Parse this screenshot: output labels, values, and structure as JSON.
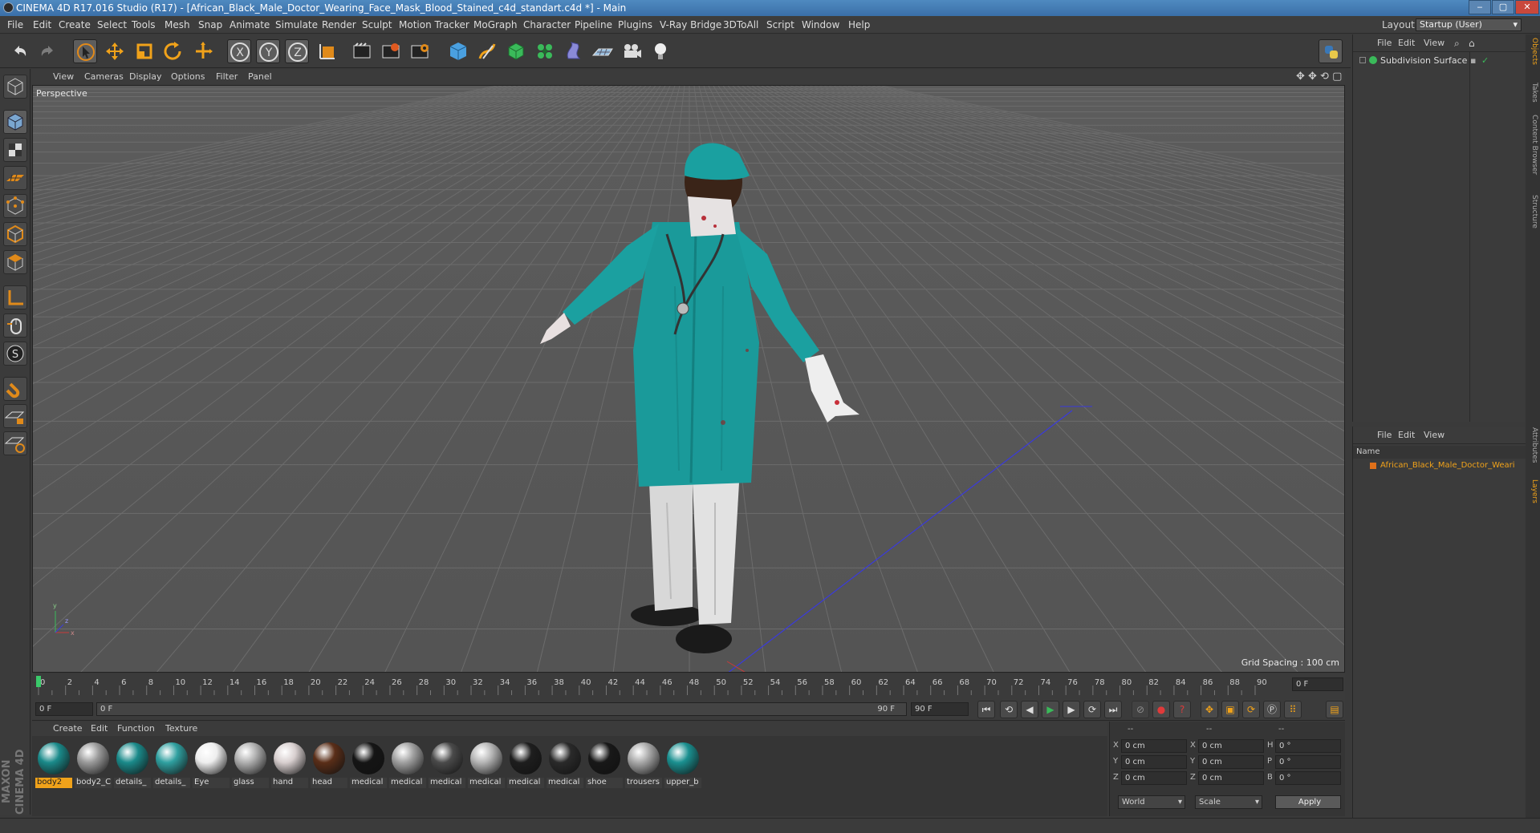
{
  "window": {
    "title": "CINEMA 4D R17.016 Studio (R17) - [African_Black_Male_Doctor_Wearing_Face_Mask_Blood_Stained_c4d_standart.c4d *] - Main",
    "minimize": "‒",
    "maximize": "▢",
    "close": "✕"
  },
  "menu": [
    "File",
    "Edit",
    "Create",
    "Select",
    "Tools",
    "Mesh",
    "Snap",
    "Animate",
    "Simulate",
    "Render",
    "Sculpt",
    "Motion Tracker",
    "MoGraph",
    "Character",
    "Pipeline",
    "Plugins",
    "V-Ray Bridge",
    "3DToAll",
    "Script",
    "Window",
    "Help"
  ],
  "layout": {
    "label": "Layout:",
    "value": "Startup (User)"
  },
  "toolbar": {
    "icons": [
      "undo-icon",
      "redo-icon",
      "live-selection-icon",
      "move-icon",
      "scale-icon",
      "rotate-icon",
      "recent-tool-icon",
      "x-axis-icon",
      "y-axis-icon",
      "z-axis-icon",
      "coordinate-system-icon",
      "render-view-icon",
      "render-picture-viewer-icon",
      "edit-render-settings-icon",
      "cube-icon",
      "pen-icon",
      "subdivision-icon",
      "cloner-icon",
      "deformer-icon",
      "floor-icon",
      "camera-icon",
      "light-icon"
    ],
    "axis_x": "X",
    "axis_y": "Y",
    "axis_z": "Z"
  },
  "viewport": {
    "menu": [
      "View",
      "Cameras",
      "Display",
      "Options",
      "Filter",
      "Panel"
    ],
    "label": "Perspective",
    "grid_spacing": "Grid Spacing : 100 cm"
  },
  "timeline": {
    "ticks": [
      "0",
      "2",
      "4",
      "6",
      "8",
      "10",
      "12",
      "14",
      "16",
      "18",
      "20",
      "22",
      "24",
      "26",
      "28",
      "30",
      "32",
      "34",
      "36",
      "38",
      "40",
      "42",
      "44",
      "46",
      "48",
      "50",
      "52",
      "54",
      "56",
      "58",
      "60",
      "62",
      "64",
      "66",
      "68",
      "70",
      "72",
      "74",
      "76",
      "78",
      "80",
      "82",
      "84",
      "86",
      "88",
      "90"
    ],
    "current_frame": "0 F",
    "start_field": "0 F",
    "slider_start": "0 F",
    "slider_end": "90 F",
    "end_field": "90 F"
  },
  "materials_menu": [
    "Create",
    "Edit",
    "Function",
    "Texture"
  ],
  "materials": [
    {
      "name": "body2",
      "color": "#1a8a8a",
      "selected": true
    },
    {
      "name": "body2_C",
      "color": "#9a9a9a",
      "selected": false
    },
    {
      "name": "details_",
      "color": "#1a8a8a",
      "selected": false
    },
    {
      "name": "details_",
      "color": "#2fa0a0",
      "selected": false
    },
    {
      "name": "Eye",
      "color": "#eeeeee",
      "selected": false
    },
    {
      "name": "glass",
      "color": "#b0b0b0",
      "selected": false
    },
    {
      "name": "hand",
      "color": "#d8cfcf",
      "selected": false
    },
    {
      "name": "head",
      "color": "#5a2e18",
      "selected": false
    },
    {
      "name": "medical",
      "color": "#151515",
      "selected": false
    },
    {
      "name": "medical",
      "color": "#a0a0a0",
      "selected": false
    },
    {
      "name": "medical",
      "color": "#4a4a4a",
      "selected": false
    },
    {
      "name": "medical",
      "color": "#b5b5b5",
      "selected": false
    },
    {
      "name": "medical",
      "color": "#1e1e1e",
      "selected": false
    },
    {
      "name": "medical",
      "color": "#2a2a2a",
      "selected": false
    },
    {
      "name": "shoe",
      "color": "#181818",
      "selected": false
    },
    {
      "name": "trousers",
      "color": "#a8a8a8",
      "selected": false
    },
    {
      "name": "upper_b",
      "color": "#1a9090",
      "selected": false
    }
  ],
  "coords": {
    "header": [
      "--",
      "--",
      "--"
    ],
    "rows": [
      {
        "axis": "X",
        "pos": "0 cm",
        "axis2": "X",
        "size": "0 cm",
        "axis3": "H",
        "rot": "0 °"
      },
      {
        "axis": "Y",
        "pos": "0 cm",
        "axis2": "Y",
        "size": "0 cm",
        "axis3": "P",
        "rot": "0 °"
      },
      {
        "axis": "Z",
        "pos": "0 cm",
        "axis2": "Z",
        "size": "0 cm",
        "axis3": "B",
        "rot": "0 °"
      }
    ],
    "world": "World",
    "scale": "Scale",
    "apply": "Apply"
  },
  "object_manager": {
    "menu": [
      "File",
      "Edit",
      "View"
    ],
    "objects": [
      {
        "name": "Subdivision Surface"
      }
    ]
  },
  "layer_manager": {
    "menu": [
      "File",
      "Edit",
      "View"
    ],
    "column": "Name",
    "items": [
      {
        "name": "African_Black_Male_Doctor_Weari"
      }
    ]
  },
  "side_tabs": [
    "Objects",
    "Takes",
    "Content Browser",
    "Structure",
    "Attributes",
    "Layers"
  ],
  "brand": "MAXON CINEMA 4D",
  "colors": {
    "accent": "#f0a21a",
    "teal": "#1a9a9a"
  }
}
